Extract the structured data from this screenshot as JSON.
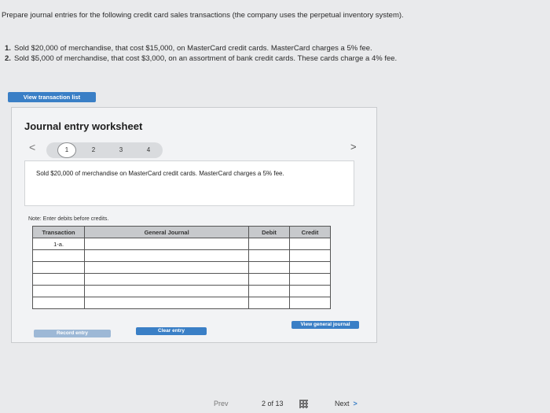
{
  "intro": "Prepare journal entries for the following credit card sales transactions (the company uses the perpetual inventory system).",
  "requirements": [
    {
      "num": "1.",
      "text": "Sold $20,000 of merchandise, that cost $15,000, on MasterCard credit cards. MasterCard charges a 5% fee."
    },
    {
      "num": "2.",
      "text": "Sold $5,000 of merchandise, that cost $3,000, on an assortment of bank credit cards. These cards charge a 4% fee."
    }
  ],
  "view_transaction_list": "View transaction list",
  "worksheet": {
    "title": "Journal entry worksheet",
    "prev_arrow": "<",
    "next_arrow": ">",
    "pages": [
      "1",
      "2",
      "3",
      "4"
    ],
    "active_page": "1",
    "description": "Sold $20,000 of merchandise on MasterCard credit cards. MasterCard charges a 5% fee.",
    "note": "Note: Enter debits before credits.",
    "table": {
      "headers": [
        "Transaction",
        "General Journal",
        "Debit",
        "Credit"
      ],
      "rows": [
        [
          "1-a.",
          "",
          "",
          ""
        ],
        [
          "",
          "",
          "",
          ""
        ],
        [
          "",
          "",
          "",
          ""
        ],
        [
          "",
          "",
          "",
          ""
        ],
        [
          "",
          "",
          "",
          ""
        ],
        [
          "",
          "",
          "",
          ""
        ]
      ]
    },
    "buttons": {
      "record": "Record entry",
      "clear": "Clear entry",
      "view_general_journal": "View general journal"
    }
  },
  "footer": {
    "prev": "Prev",
    "page_info": "2 of 13",
    "next": "Next",
    "next_chevron": ">"
  }
}
